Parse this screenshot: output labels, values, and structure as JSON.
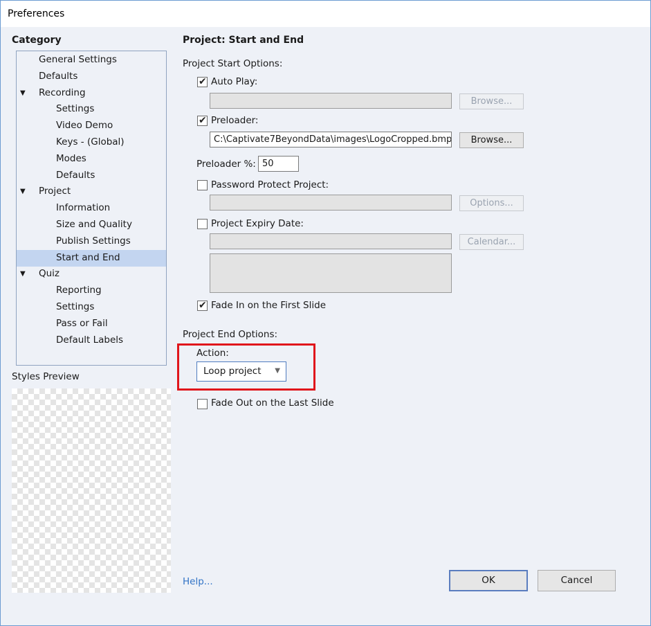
{
  "window": {
    "title": "Preferences"
  },
  "category": {
    "heading": "Category",
    "items": [
      {
        "label": "General Settings",
        "level": 0
      },
      {
        "label": "Defaults",
        "level": 0
      },
      {
        "label": "Recording",
        "level": 0,
        "expanded": true
      },
      {
        "label": "Settings",
        "level": 1
      },
      {
        "label": "Video Demo",
        "level": 1
      },
      {
        "label": "Keys - (Global)",
        "level": 1
      },
      {
        "label": "Modes",
        "level": 1
      },
      {
        "label": "Defaults",
        "level": 1
      },
      {
        "label": "Project",
        "level": 0,
        "expanded": true
      },
      {
        "label": "Information",
        "level": 1
      },
      {
        "label": "Size and Quality",
        "level": 1
      },
      {
        "label": "Publish Settings",
        "level": 1
      },
      {
        "label": "Start and End",
        "level": 1,
        "selected": true
      },
      {
        "label": "Quiz",
        "level": 0,
        "expanded": true
      },
      {
        "label": "Reporting",
        "level": 1
      },
      {
        "label": "Settings",
        "level": 1
      },
      {
        "label": "Pass or Fail",
        "level": 1
      },
      {
        "label": "Default Labels",
        "level": 1
      }
    ]
  },
  "styles_preview": {
    "label": "Styles Preview"
  },
  "page": {
    "title": "Project: Start and End",
    "start_options_label": "Project Start Options:",
    "auto_play": {
      "label": "Auto Play:",
      "checked": true,
      "path": "",
      "browse_label": "Browse..."
    },
    "preloader": {
      "label": "Preloader:",
      "checked": true,
      "path": "C:\\Captivate7BeyondData\\images\\LogoCropped.bmp",
      "browse_label": "Browse..."
    },
    "preloader_percent": {
      "label": "Preloader %:",
      "value": "50"
    },
    "password": {
      "label": "Password Protect Project:",
      "checked": false,
      "options_label": "Options..."
    },
    "expiry": {
      "label": "Project Expiry Date:",
      "checked": false,
      "calendar_label": "Calendar..."
    },
    "fade_in": {
      "label": "Fade In on the First Slide",
      "checked": true
    },
    "end_options_label": "Project End Options:",
    "action": {
      "label": "Action:",
      "value": "Loop project"
    },
    "fade_out": {
      "label": "Fade Out on the Last Slide",
      "checked": false
    }
  },
  "footer": {
    "help_label": "Help...",
    "ok_label": "OK",
    "cancel_label": "Cancel"
  },
  "colors": {
    "selection": "#c3d5f0",
    "highlight_border": "#e0151b",
    "link": "#3173c6"
  },
  "icons": {
    "check": "check-icon",
    "expand": "triangle-down-icon",
    "dropdown": "chevron-down-icon"
  }
}
